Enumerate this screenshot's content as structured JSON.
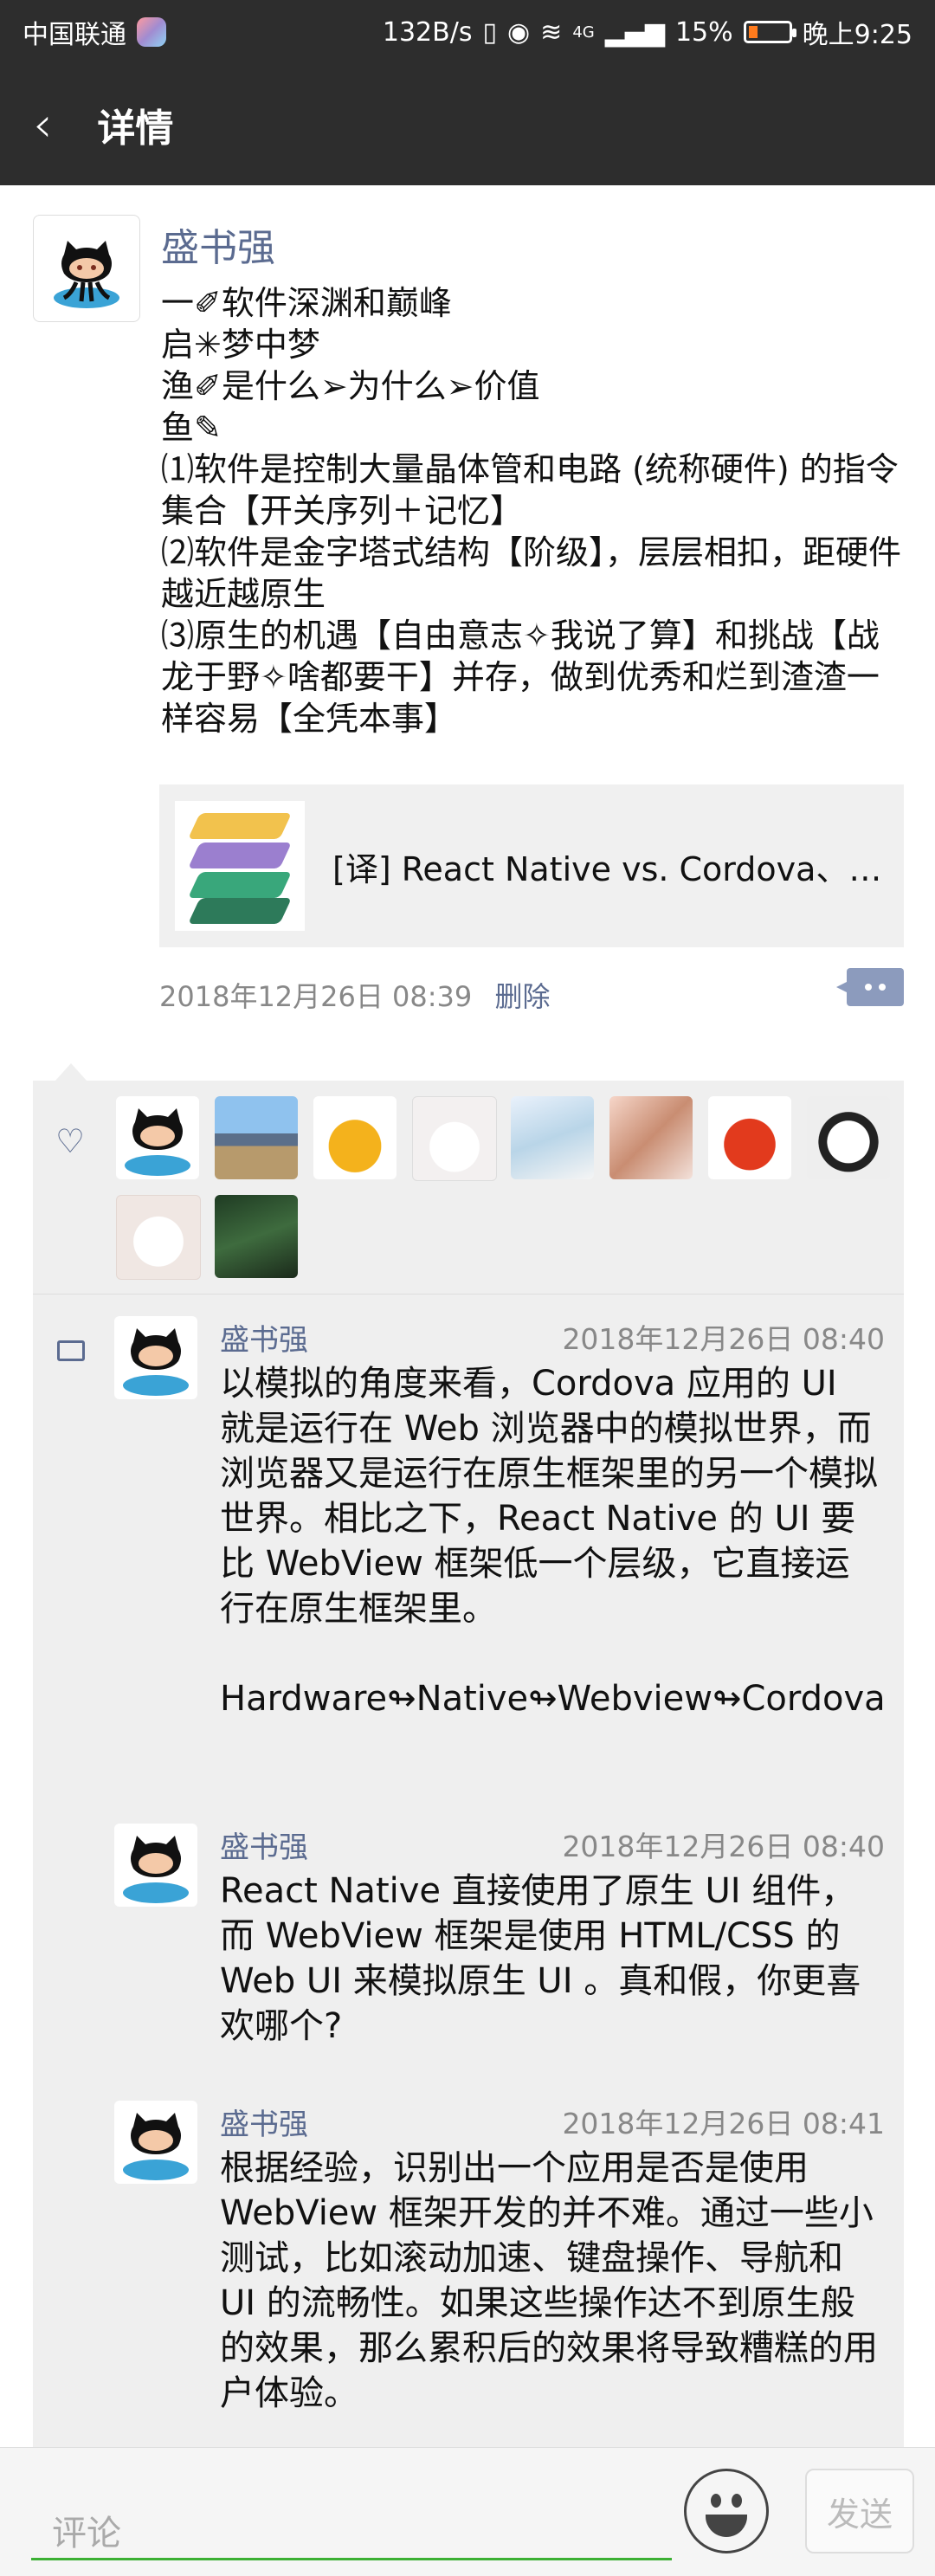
{
  "status_bar": {
    "carrier": "中国联通",
    "network_speed": "132B/s",
    "signal": "4G",
    "battery": "15%",
    "time": "晚上9:25"
  },
  "navbar": {
    "back_icon": "chevron-left",
    "title": "详情"
  },
  "post": {
    "author": "盛书强",
    "text": "一✐软件深渊和巅峰\n启✳梦中梦\n渔✐是什么➢为什么➢价值\n鱼✎\n⑴软件是控制大量晶体管和电路 (统称硬件) 的指令集合【开关序列＋记忆】\n⑵软件是金字塔式结构【阶级】，层层相扣，距硬件越近越原生\n⑶原生的机遇【自由意志✧我说了算】和挑战【战龙于野✧啥都要干】并存，做到优秀和烂到渣渣一样容易【全凭本事】",
    "link_title": "[译] React Native vs. Cordova、P...",
    "date": "2018年12月26日 08:39",
    "delete_label": "删除"
  },
  "likes": {
    "icon": "heart-outline",
    "count": 10
  },
  "comments": [
    {
      "author": "盛书强",
      "time": "2018年12月26日 08:40",
      "text": "以模拟的角度来看，Cordova 应用的 UI 就是运行在 Web 浏览器中的模拟世界，而浏览器又是运行在原生框架里的另一个模拟世界。相比之下，React Native 的 UI 要比 WebView 框架低一个层级，它直接运行在原生框架里。\n\nHardware↬Native↬Webview↬Cordova"
    },
    {
      "author": "盛书强",
      "time": "2018年12月26日 08:40",
      "text": "React Native 直接使用了原生 UI 组件，而 WebView 框架是使用 HTML/CSS 的 Web UI 来模拟原生 UI 。真和假，你更喜欢哪个?"
    },
    {
      "author": "盛书强",
      "time": "2018年12月26日 08:41",
      "text": "根据经验，识别出一个应用是否是使用 WebView 框架开发的并不难。通过一些小测试，比如滚动加速、键盘操作、导航和 UI 的流畅性。如果这些操作达不到原生般的效果，那么累积后的效果将导致糟糕的用户体验。"
    }
  ],
  "input_bar": {
    "placeholder": "评论",
    "send_label": "发送"
  },
  "colors": {
    "header_bg": "#2d2d2d",
    "name_blue": "#5b6b90",
    "input_green": "#3cb034"
  }
}
